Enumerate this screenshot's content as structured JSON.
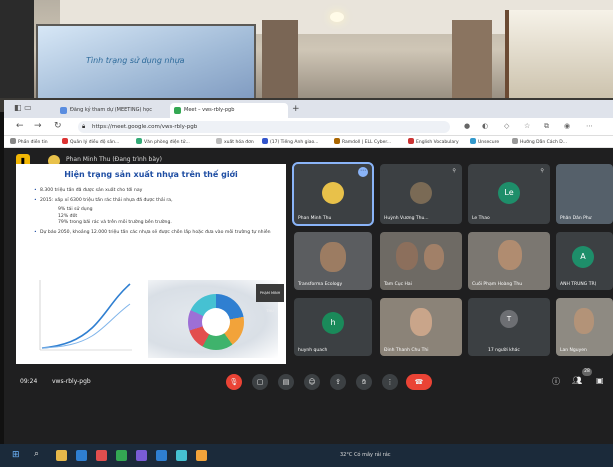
{
  "room": {
    "projector_text": "Tình trạng sử dụng nhựa"
  },
  "browser": {
    "tabs": [
      {
        "label": "Đăng ký tham dự (MEETING) học"
      },
      {
        "label": "Meet – vws-rbly-pgb"
      }
    ],
    "new_tab": "+",
    "url": "https://meet.google.com/vws-rbly-pgb",
    "bookmarks": [
      "Phần điền tin",
      "Quản lý điều độ sản...",
      "Văn phòng điện tử...",
      "xuất hóa đơn",
      "(17) Tiếng Anh giao...",
      "Ramdoll | ELL Cyber...",
      "English Vocabulary",
      "Unsecure",
      "Hướng Dẫn Cách D..."
    ]
  },
  "meet": {
    "presenter_label": "Phan Minh Thu (Đang trình bày)",
    "slide": {
      "title": "Hiện trạng sản xuất nhựa trên thế giới",
      "bullets": [
        "8.300 triệu tấn đã được sản xuất cho tới nay",
        "2015: xấp xỉ 6300 triệu tấn rác thải nhựa đã được thải ra,",
        "Dự báo 2050, khoảng 12.000 triệu tấn các nhựa sẽ được chôn lấp hoặc đưa vào môi trường tự nhiên"
      ],
      "subs": [
        "9% tái sử dụng",
        "12% đốt",
        "79% trong bãi rác và trên môi trường bên trường."
      ],
      "pip_label": "PHẠM MINH THU"
    },
    "tiles": [
      {
        "name": "Phan Minh Thu"
      },
      {
        "name": "Huỳnh Vương Thu..."
      },
      {
        "name": "Le Thao",
        "initial": "Le"
      },
      {
        "name": "Phân Dân Phư"
      },
      {
        "name": "Transforma Ecology"
      },
      {
        "name": "Tam Cục Hai"
      },
      {
        "name": "Cuối Phạm Hoàng Thu"
      },
      {
        "name": "ANH TRUNG TRỊ",
        "initial": "A"
      },
      {
        "name": "huynh quach",
        "initial": "h"
      },
      {
        "name": "Đinh Thanh Chu Thi"
      },
      {
        "name": "17 người khác",
        "count": "T"
      },
      {
        "name": "Lan Nguyen"
      }
    ],
    "time": "09:24",
    "code": "vws-rbly-pgb",
    "people_count": "28"
  },
  "taskbar": {
    "tray_text": "32°C Có mây rải rác"
  }
}
